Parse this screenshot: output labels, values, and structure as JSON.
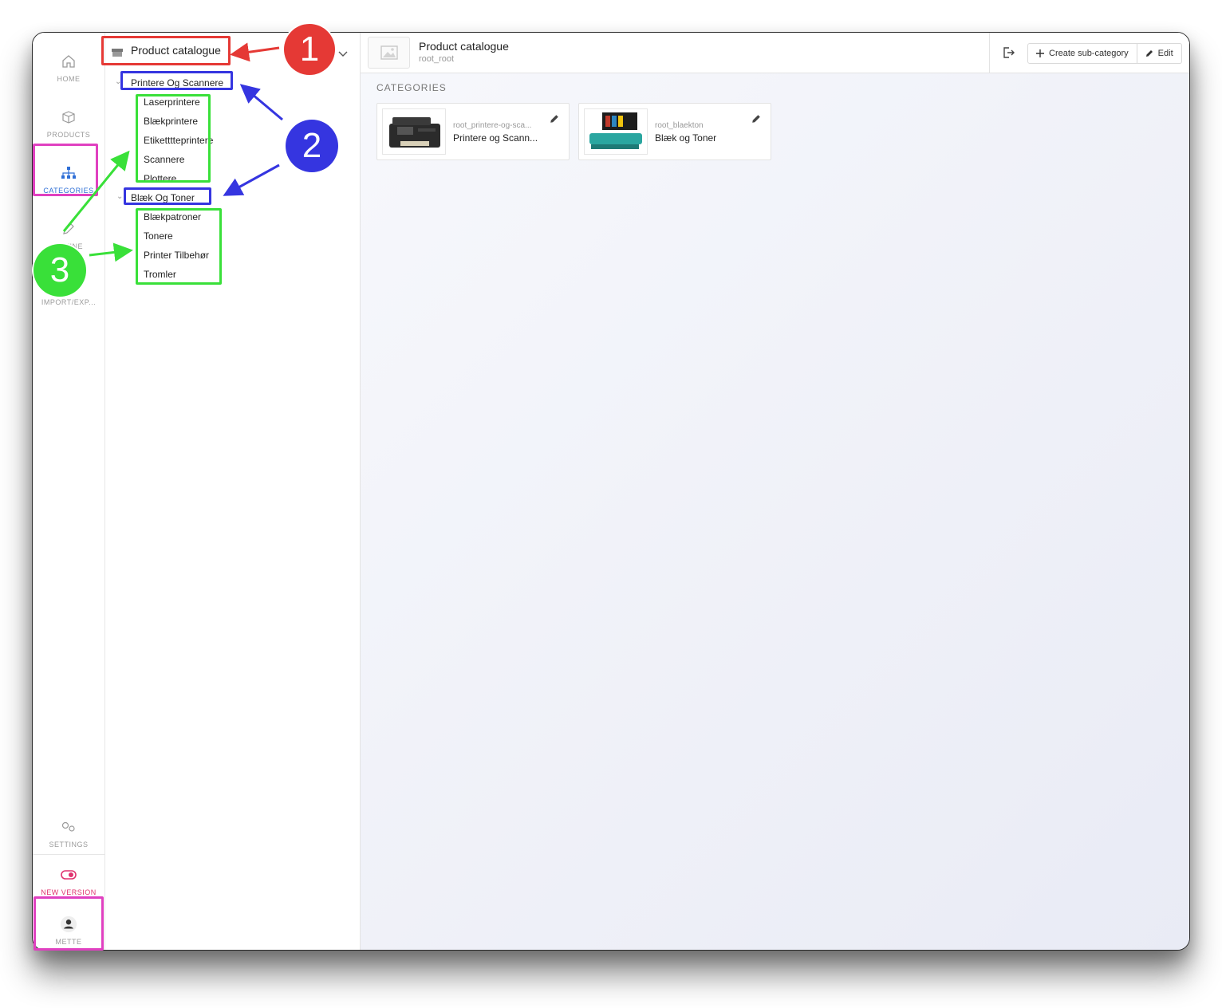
{
  "rail": {
    "home": "HOME",
    "products": "PRODUCTS",
    "categories": "CATEGORIES",
    "define": "DEFINE",
    "import_export": "IMPORT/EXP...",
    "settings": "SETTINGS",
    "new_version": "NEW VERSION",
    "user": "METTE"
  },
  "tree": {
    "root_label": "Product catalogue",
    "groups": [
      {
        "label": "Printere Og Scannere",
        "children": [
          "Laserprintere",
          "Blækprintere",
          "Etiketttteprintere",
          "Scannere",
          "Plottere"
        ]
      },
      {
        "label": "Blæk Og Toner",
        "children": [
          "Blækpatroner",
          "Tonere",
          "Printer Tilbehør",
          "Tromler"
        ]
      }
    ]
  },
  "header": {
    "title": "Product catalogue",
    "subtitle": "root_root",
    "create_label": "Create sub-category",
    "edit_label": "Edit"
  },
  "main": {
    "section_title": "CATEGORIES",
    "cards": [
      {
        "code": "root_printere-og-sca...",
        "name": "Printere og Scann..."
      },
      {
        "code": "root_blaekton",
        "name": "Blæk og Toner"
      }
    ]
  },
  "annotations": {
    "badge_1": "1",
    "badge_2": "2",
    "badge_3": "3",
    "colors": {
      "red": "#e53935",
      "blue": "#3535e0",
      "green": "#39e039",
      "magenta": "#e040c0"
    }
  }
}
